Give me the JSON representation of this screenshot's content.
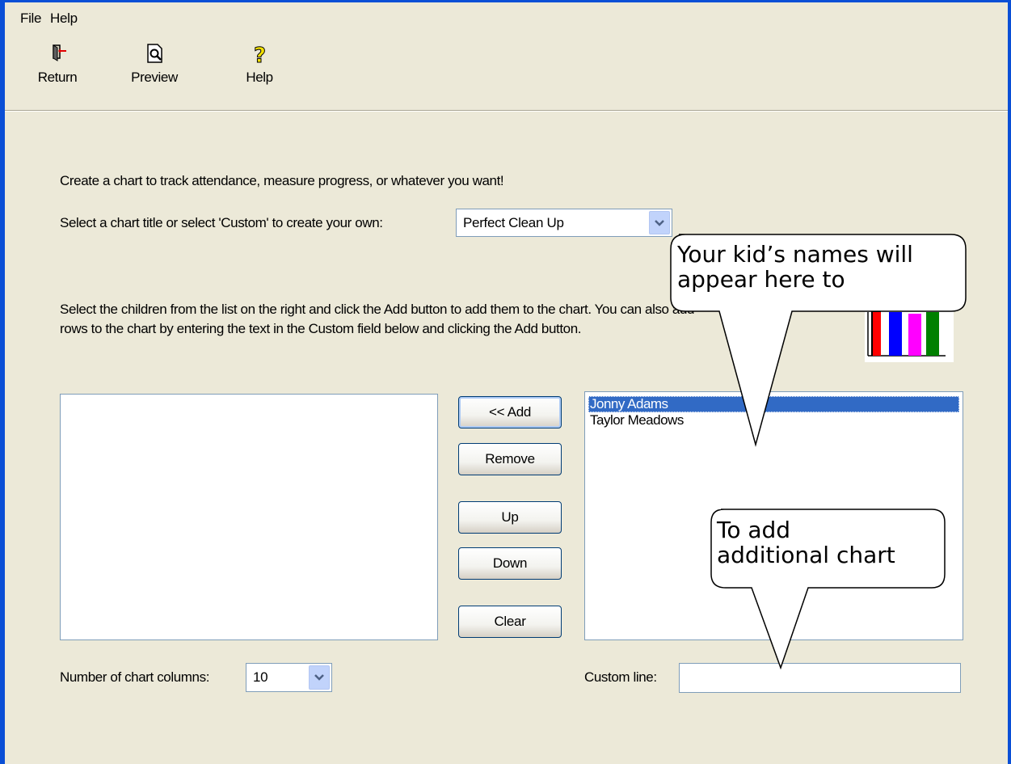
{
  "menu": {
    "file": "File",
    "help": "Help"
  },
  "toolbar": {
    "return_label": "Return",
    "preview_label": "Preview",
    "help_label": "Help"
  },
  "main": {
    "intro": "Create a chart to track attendance, measure progress, or whatever you want!",
    "title_prompt": "Select a chart title or select 'Custom' to create your own:",
    "title_value": "Perfect Clean Up",
    "instructions_line1": "Select the children from the list on the right and click the Add button to add them to the chart. You can also add",
    "instructions_line2": "rows to the chart by entering the text in the Custom field below and clicking the Add button.",
    "available_children": [
      "Jonny Adams",
      "Taylor Meadows"
    ],
    "buttons": {
      "add": "<< Add",
      "remove": "Remove",
      "up": "Up",
      "down": "Down",
      "clear": "Clear"
    },
    "columns_label": "Number of chart columns:",
    "columns_value": "10",
    "custom_line_label": "Custom line:",
    "custom_line_value": ""
  },
  "callouts": {
    "names": {
      "line1": "Your kid’s names will",
      "line2": "appear here to"
    },
    "custom": {
      "line1": "To add",
      "line2": "additional chart"
    }
  },
  "colors": {
    "window_bg": "#ece9d8",
    "frame": "#0a4fd6",
    "selection": "#316ac5",
    "chart_bars": [
      "#ff0000",
      "#0000ff",
      "#ff00ff",
      "#008000"
    ]
  },
  "icons": {
    "return": "exit-door-icon",
    "preview": "print-preview-icon",
    "help": "question-mark-icon",
    "chart": "bar-chart-icon"
  }
}
